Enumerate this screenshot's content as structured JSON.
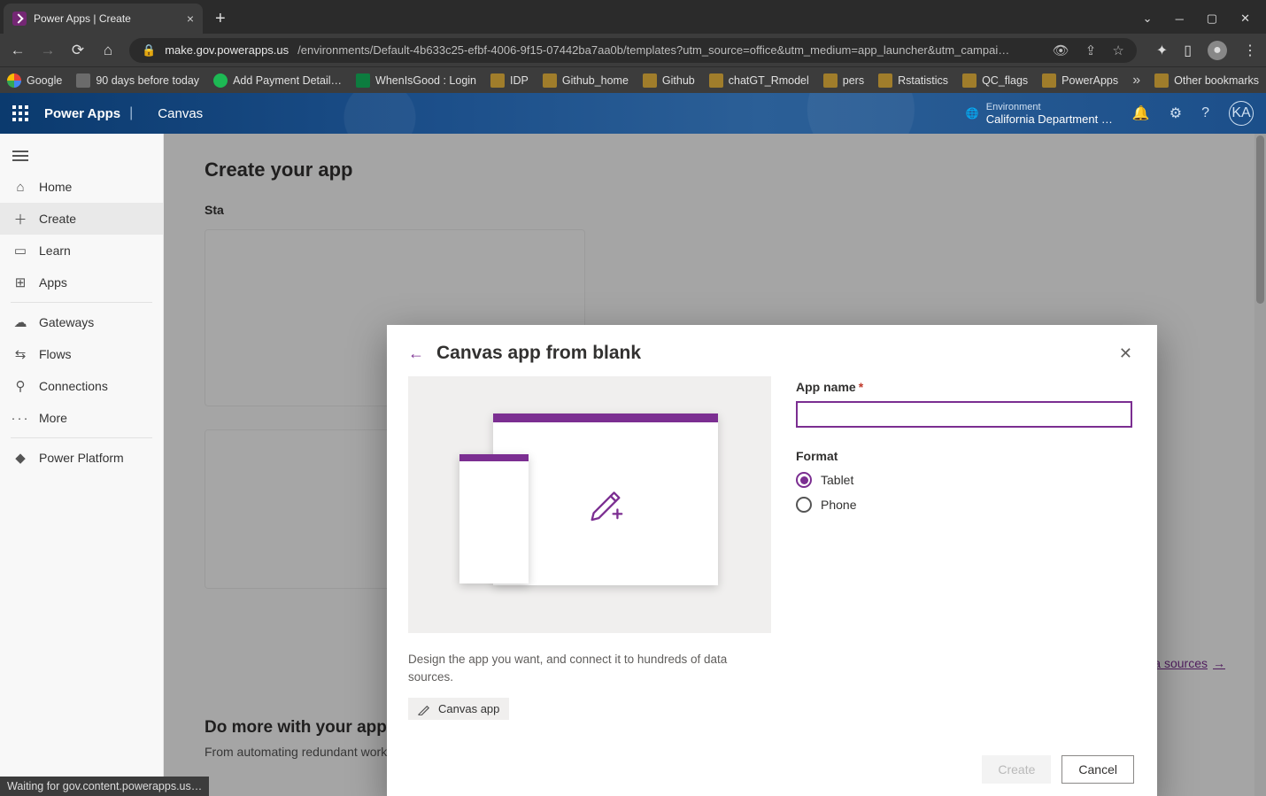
{
  "browser": {
    "tab_title": "Power Apps | Create",
    "url_host": "make.gov.powerapps.us",
    "url_path": "/environments/Default-4b633c25-efbf-4006-9f15-07442ba7aa0b/templates?utm_source=office&utm_medium=app_launcher&utm_campai…",
    "bookmarks": [
      "Google",
      "90 days before today",
      "Add Payment Detail…",
      "WhenIsGood : Login",
      "IDP",
      "Github_home",
      "Github",
      "chatGT_Rmodel",
      "pers",
      "Rstatistics",
      "QC_flags",
      "PowerApps"
    ],
    "other_bookmarks": "Other bookmarks"
  },
  "app_header": {
    "product": "Power Apps",
    "area": "Canvas",
    "env_label": "Environment",
    "env_value": "California Department …",
    "avatar": "KA"
  },
  "nav": {
    "items": [
      "Home",
      "Create",
      "Learn",
      "Apps",
      "Gateways",
      "Flows",
      "Connections",
      "More",
      "Power Platform"
    ],
    "active": "Create"
  },
  "page": {
    "heading": "Create your app",
    "sub1": "Sta",
    "more_link": "More data sources",
    "section2_title": "Do more with your apps",
    "section2_desc": "From automating redundant workflows to AI-infused business insights, extend your apps' capabilities with these options from across the Power Platform."
  },
  "modal": {
    "title": "Canvas app from blank",
    "description": "Design the app you want, and connect it to hundreds of data sources.",
    "chip": "Canvas app",
    "app_name_label": "App name",
    "app_name_value": "",
    "format_label": "Format",
    "format_options": {
      "tablet": "Tablet",
      "phone": "Phone"
    },
    "format_selected": "tablet",
    "create_btn": "Create",
    "cancel_btn": "Cancel"
  },
  "status": "Waiting for gov.content.powerapps.us…"
}
